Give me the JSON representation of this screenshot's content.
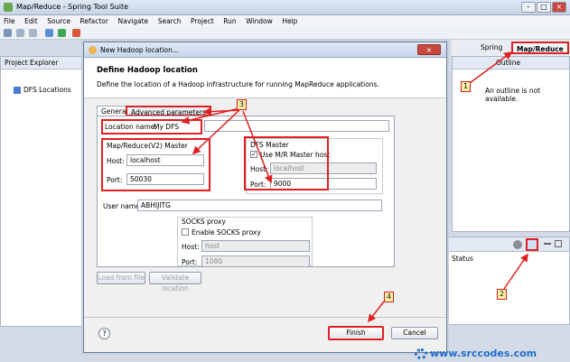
{
  "window": {
    "title": "Map/Reduce - Spring Tool Suite"
  },
  "menu": [
    "File",
    "Edit",
    "Source",
    "Refactor",
    "Navigate",
    "Search",
    "Project",
    "Run",
    "Window",
    "Help"
  ],
  "perspectives": {
    "spring": "Spring",
    "mapreduce": "Map/Reduce"
  },
  "project_explorer": {
    "title": "Project Explorer",
    "item": "DFS Locations"
  },
  "outline": {
    "title": "Outline",
    "message": "An outline is not available."
  },
  "bottom_panel": {
    "column": "Status"
  },
  "dialog": {
    "title": "New Hadoop location...",
    "heading": "Define Hadoop location",
    "description": "Define the location of a Hadoop infrastructure for running MapReduce applications.",
    "tabs": [
      "General",
      "Advanced parameters"
    ],
    "location_name": {
      "label": "Location name:",
      "value": "My DFS"
    },
    "mr_master": {
      "legend": "Map/Reduce(V2) Master",
      "host_label": "Host:",
      "host": "localhost",
      "port_label": "Port:",
      "port": "50030"
    },
    "dfs_master": {
      "legend": "DFS Master",
      "use_mr": "Use M/R Master host",
      "host_label": "Host:",
      "host": "localhost",
      "port_label": "Port:",
      "port": "9000"
    },
    "user_name": {
      "label": "User name:",
      "value": "ABHIJITG"
    },
    "socks": {
      "legend": "SOCKS proxy",
      "enable": "Enable SOCKS proxy",
      "host_label": "Host:",
      "host": "host",
      "port_label": "Port:",
      "port": "1080"
    },
    "buttons": {
      "load": "Load from file",
      "validate": "Validate location",
      "finish": "Finish",
      "cancel": "Cancel"
    },
    "help": "?"
  },
  "annotations": [
    "1",
    "2",
    "3",
    "4"
  ],
  "watermark": "www.srccodes.com",
  "colors": {
    "highlight": "#e02020",
    "annotation_bg": "#fff2a8",
    "watermark": "#1f6fd0"
  }
}
